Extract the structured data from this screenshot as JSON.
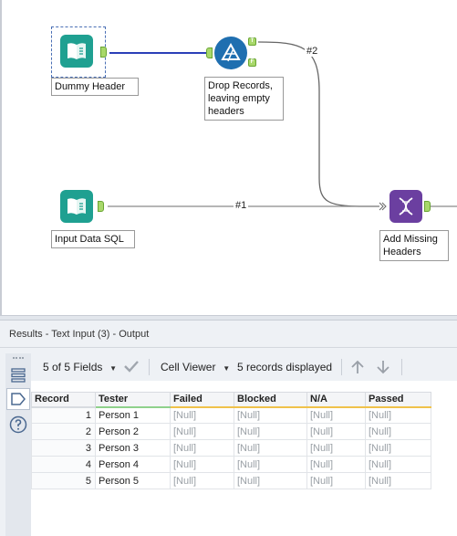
{
  "canvas": {
    "tools": {
      "dummy_header": {
        "label": "Dummy Header",
        "icon": "text-input-book-icon"
      },
      "drop_records": {
        "label": "Drop Records, leaving empty headers",
        "icon": "filter-triangle-icon",
        "true_anchor": "T",
        "false_anchor": "F"
      },
      "input_data_sql": {
        "label": "Input Data SQL",
        "icon": "text-input-book-icon"
      },
      "add_missing_headers": {
        "label": "Add Missing Headers",
        "icon": "union-dna-icon"
      }
    },
    "connections": {
      "wire1_label": "#1",
      "wire2_label": "#2"
    }
  },
  "results": {
    "title": "Results - Text Input (3) - Output",
    "toolbar": {
      "fields_selector": "5 of 5 Fields",
      "viewer_selector": "Cell Viewer",
      "records_status": "5 records displayed"
    },
    "rail": {
      "icons": [
        "table-view-icon",
        "metadata-tag-icon",
        "help-icon"
      ]
    },
    "grid": {
      "columns": [
        "Record",
        "Tester",
        "Failed",
        "Blocked",
        "N/A",
        "Passed"
      ],
      "rows": [
        [
          "1",
          "Person 1",
          "[Null]",
          "[Null]",
          "[Null]",
          "[Null]"
        ],
        [
          "2",
          "Person 2",
          "[Null]",
          "[Null]",
          "[Null]",
          "[Null]"
        ],
        [
          "3",
          "Person 3",
          "[Null]",
          "[Null]",
          "[Null]",
          "[Null]"
        ],
        [
          "4",
          "Person 4",
          "[Null]",
          "[Null]",
          "[Null]",
          "[Null]"
        ],
        [
          "5",
          "Person 5",
          "[Null]",
          "[Null]",
          "[Null]",
          "[Null]"
        ]
      ]
    }
  }
}
